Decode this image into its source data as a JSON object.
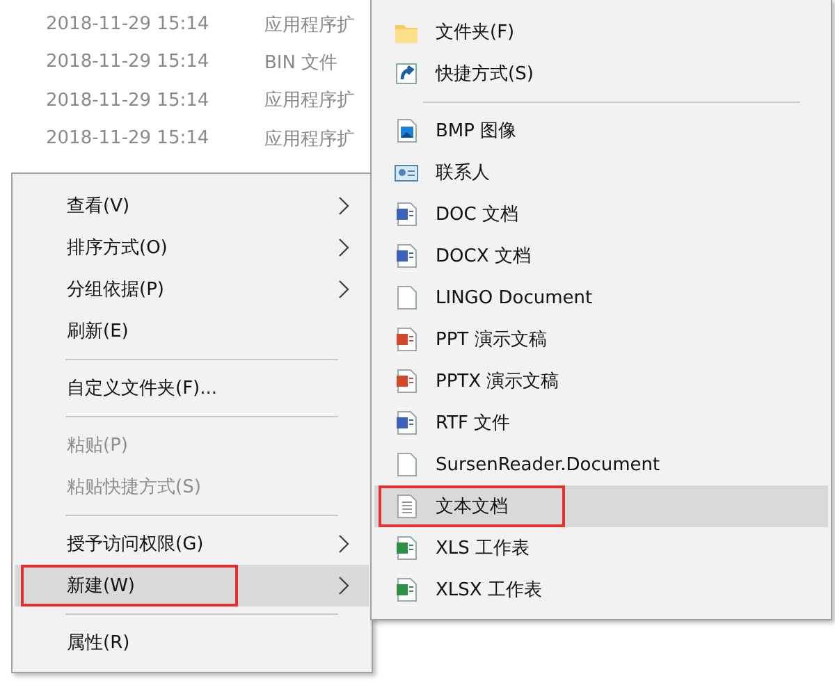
{
  "file_list": [
    {
      "date": "2018-11-29 15:14",
      "type": "应用程序扩"
    },
    {
      "date": "2018-11-29 15:14",
      "type": "BIN 文件"
    },
    {
      "date": "2018-11-29 15:14",
      "type": "应用程序扩"
    },
    {
      "date": "2018-11-29 15:14",
      "type": "应用程序扩"
    }
  ],
  "context_menu": {
    "items": [
      {
        "kind": "item",
        "label": "查看(V)",
        "submenu": true,
        "disabled": false,
        "selected": false,
        "annotated": false
      },
      {
        "kind": "item",
        "label": "排序方式(O)",
        "submenu": true,
        "disabled": false,
        "selected": false,
        "annotated": false
      },
      {
        "kind": "item",
        "label": "分组依据(P)",
        "submenu": true,
        "disabled": false,
        "selected": false,
        "annotated": false
      },
      {
        "kind": "item",
        "label": "刷新(E)",
        "submenu": false,
        "disabled": false,
        "selected": false,
        "annotated": false
      },
      {
        "kind": "separator"
      },
      {
        "kind": "item",
        "label": "自定义文件夹(F)...",
        "submenu": false,
        "disabled": false,
        "selected": false,
        "annotated": false
      },
      {
        "kind": "separator"
      },
      {
        "kind": "item",
        "label": "粘贴(P)",
        "submenu": false,
        "disabled": true,
        "selected": false,
        "annotated": false
      },
      {
        "kind": "item",
        "label": "粘贴快捷方式(S)",
        "submenu": false,
        "disabled": true,
        "selected": false,
        "annotated": false
      },
      {
        "kind": "separator"
      },
      {
        "kind": "item",
        "label": "授予访问权限(G)",
        "submenu": true,
        "disabled": false,
        "selected": false,
        "annotated": false
      },
      {
        "kind": "item",
        "label": "新建(W)",
        "submenu": true,
        "disabled": false,
        "selected": true,
        "annotated": true
      },
      {
        "kind": "separator"
      },
      {
        "kind": "item",
        "label": "属性(R)",
        "submenu": false,
        "disabled": false,
        "selected": false,
        "annotated": false
      }
    ]
  },
  "new_submenu": {
    "items": [
      {
        "kind": "folder",
        "label": "文件夹(F)",
        "selected": false,
        "annotated": false
      },
      {
        "kind": "shortcut",
        "label": "快捷方式(S)",
        "selected": false,
        "annotated": false
      },
      {
        "kind": "separator"
      },
      {
        "kind": "image",
        "label": "BMP 图像",
        "selected": false,
        "annotated": false
      },
      {
        "kind": "contact",
        "label": "联系人",
        "selected": false,
        "annotated": false
      },
      {
        "kind": "word",
        "label": "DOC 文档",
        "selected": false,
        "annotated": false
      },
      {
        "kind": "word",
        "label": "DOCX 文档",
        "selected": false,
        "annotated": false
      },
      {
        "kind": "blank",
        "label": "LINGO Document",
        "selected": false,
        "annotated": false
      },
      {
        "kind": "ppt",
        "label": "PPT 演示文稿",
        "selected": false,
        "annotated": false
      },
      {
        "kind": "ppt",
        "label": "PPTX 演示文稿",
        "selected": false,
        "annotated": false
      },
      {
        "kind": "word",
        "label": "RTF 文件",
        "selected": false,
        "annotated": false
      },
      {
        "kind": "blank",
        "label": "SursenReader.Document",
        "selected": false,
        "annotated": false
      },
      {
        "kind": "text",
        "label": "文本文档",
        "selected": true,
        "annotated": true
      },
      {
        "kind": "excel",
        "label": "XLS 工作表",
        "selected": false,
        "annotated": false
      },
      {
        "kind": "excel",
        "label": "XLSX 工作表",
        "selected": false,
        "annotated": false
      }
    ]
  }
}
